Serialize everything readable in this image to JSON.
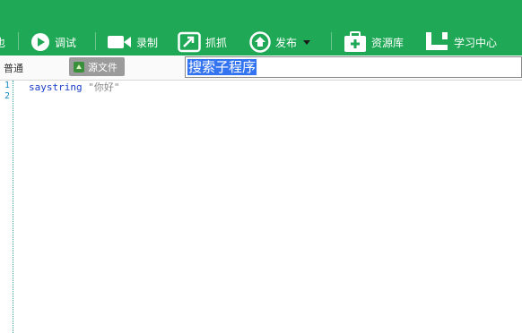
{
  "toolbar": {
    "partial_label": "也",
    "debug_label": "调试",
    "record_label": "录制",
    "capture_label": "抓抓",
    "publish_label": "发布",
    "resources_label": "资源库",
    "learning_label": "学习中心"
  },
  "subbar": {
    "mode_label": "普通",
    "source_tab_label": "源文件",
    "search_value": "搜索子程序"
  },
  "editor": {
    "line_numbers": [
      "1",
      "2"
    ],
    "line1_command": "saystring",
    "line1_string": "\"你好\""
  },
  "colors": {
    "toolbar_bg": "#1fa855",
    "selection": "#3574f0",
    "keyword": "#1a3cc9"
  }
}
